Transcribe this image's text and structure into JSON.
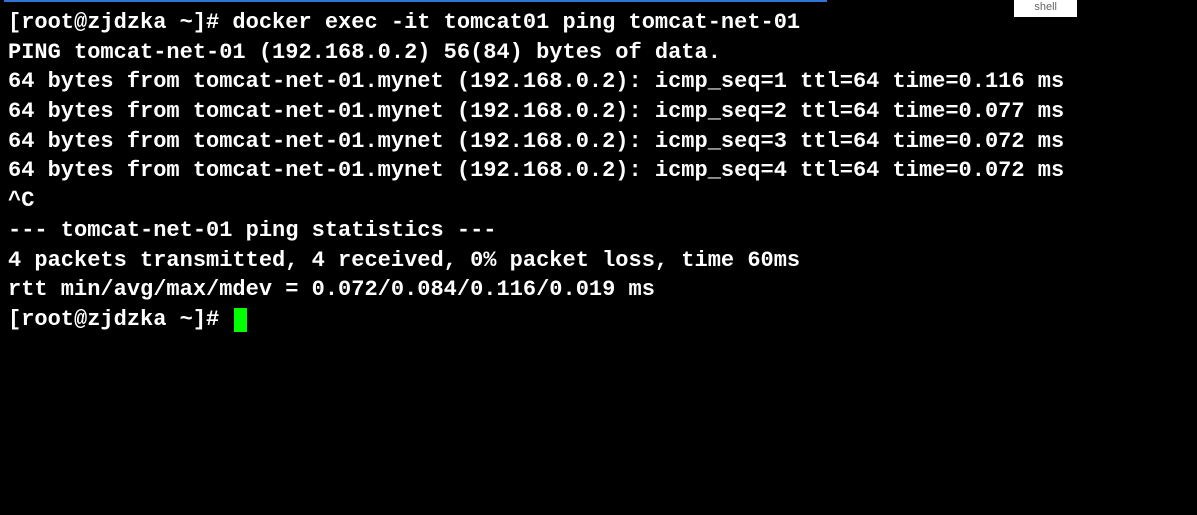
{
  "tab_label": "shell",
  "lines": [
    "[root@zjdzka ~]# docker exec -it tomcat01 ping tomcat-net-01",
    "PING tomcat-net-01 (192.168.0.2) 56(84) bytes of data.",
    "64 bytes from tomcat-net-01.mynet (192.168.0.2): icmp_seq=1 ttl=64 time=0.116 ms",
    "64 bytes from tomcat-net-01.mynet (192.168.0.2): icmp_seq=2 ttl=64 time=0.077 ms",
    "64 bytes from tomcat-net-01.mynet (192.168.0.2): icmp_seq=3 ttl=64 time=0.072 ms",
    "64 bytes from tomcat-net-01.mynet (192.168.0.2): icmp_seq=4 ttl=64 time=0.072 ms",
    "^C",
    "--- tomcat-net-01 ping statistics ---",
    "4 packets transmitted, 4 received, 0% packet loss, time 60ms",
    "rtt min/avg/max/mdev = 0.072/0.084/0.116/0.019 ms"
  ],
  "prompt_end": "[root@zjdzka ~]# "
}
